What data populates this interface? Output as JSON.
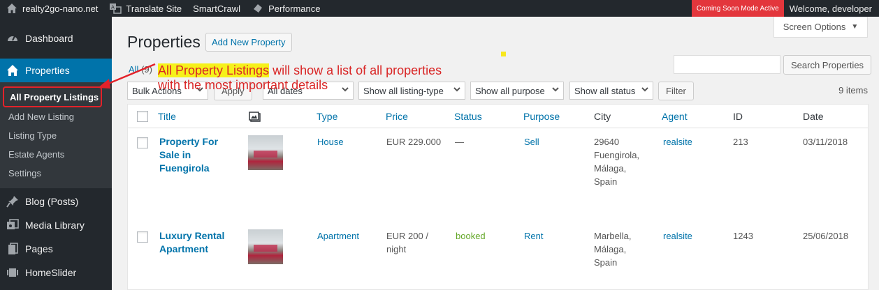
{
  "adminbar": {
    "site_name": "realty2go-nano.net",
    "translate": "Translate Site",
    "smartcrawl": "SmartCrawl",
    "performance": "Performance",
    "coming_soon": "Coming Soon Mode Active",
    "welcome": "Welcome, developer"
  },
  "sidebar": {
    "dashboard": "Dashboard",
    "properties": "Properties",
    "submenu": [
      "All Property Listings",
      "Add New Listing",
      "Listing Type",
      "Estate Agents",
      "Settings"
    ],
    "blog": "Blog (Posts)",
    "media": "Media Library",
    "pages": "Pages",
    "homeslider": "HomeSlider"
  },
  "page": {
    "title": "Properties",
    "add_new": "Add New Property",
    "screen_options": "Screen Options",
    "filter_all": "All",
    "filter_count": "(9)",
    "search_button": "Search Properties",
    "items_count": "9 items"
  },
  "tablenav": {
    "bulk_actions": "Bulk Actions",
    "apply": "Apply",
    "dates": "All dates",
    "listing_type": "Show all listing-type",
    "purpose": "Show all purpose",
    "status": "Show all status",
    "filter": "Filter"
  },
  "table": {
    "columns": [
      "Title",
      "Type",
      "Price",
      "Status",
      "Purpose",
      "City",
      "Agent",
      "ID",
      "Date"
    ],
    "rows": [
      {
        "title": [
          "Property For",
          "Sale in",
          "Fuengirola"
        ],
        "type": "House",
        "price": [
          "EUR 229.000"
        ],
        "status": "—",
        "purpose": "Sell",
        "city": [
          "29640",
          "Fuengirola,",
          "Málaga,",
          "Spain"
        ],
        "agent": "realsite",
        "id": "213",
        "date": "03/11/2018"
      },
      {
        "title": [
          "Luxury Rental",
          "Apartment"
        ],
        "type": "Apartment",
        "price": [
          "EUR 200 /",
          "night"
        ],
        "status": "booked",
        "purpose": "Rent",
        "city": [
          "Marbella,",
          "Málaga,",
          "Spain"
        ],
        "agent": "realsite",
        "id": "1243",
        "date": "25/06/2018"
      }
    ]
  },
  "annotation": {
    "highlight": "All Property Listings",
    "line1_rest": " will show a list of all properties",
    "line2": "with the most important details"
  },
  "colors": {
    "adminbar": "#23282d",
    "accent": "#0073aa",
    "coming_soon": "#e3363c",
    "annotation": "#d92626",
    "booked": "#64a828"
  }
}
